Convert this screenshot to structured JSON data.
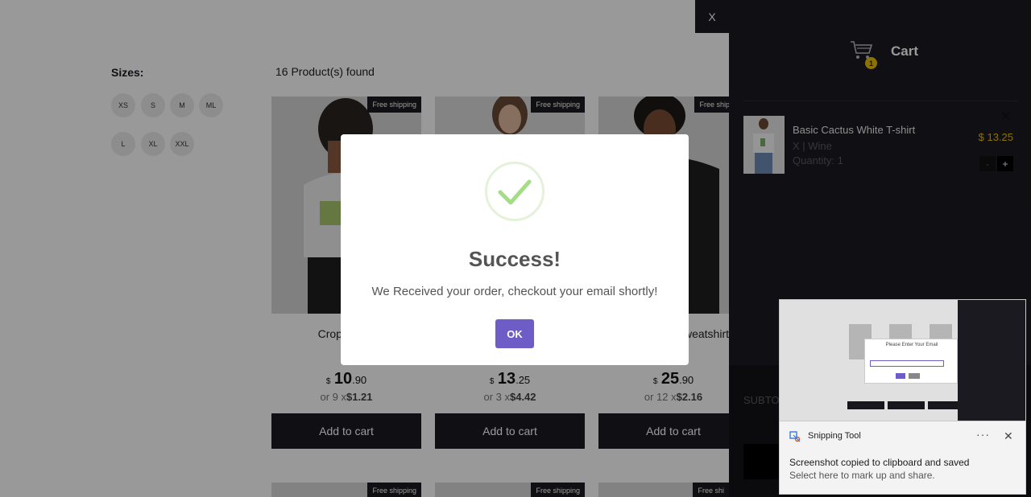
{
  "filters": {
    "title": "Sizes:",
    "sizes": [
      "XS",
      "S",
      "M",
      "ML",
      "L",
      "XL",
      "XXL"
    ]
  },
  "results": {
    "count_text": "16 Product(s) found"
  },
  "products": [
    {
      "badge": "Free shipping",
      "name": "Cropped St",
      "name_line2": "w",
      "currency": "$",
      "price_int": "10",
      "price_cents": ".90",
      "install_prefix": "or 9 x",
      "install_value": "$1.21",
      "add_label": "Add to cart"
    },
    {
      "badge": "Free shipping",
      "name": "",
      "name_line2": "",
      "currency": "$",
      "price_int": "13",
      "price_cents": ".25",
      "install_prefix": "or 3 x",
      "install_value": "$4.42",
      "add_label": "Add to cart"
    },
    {
      "badge": "Free shipping",
      "name": "weatshirt",
      "name_line2": "",
      "currency": "$",
      "price_int": "25",
      "price_cents": ".90",
      "install_prefix": "or 12 x",
      "install_value": "$2.16",
      "add_label": "Add to cart"
    }
  ],
  "products_row2": [
    {
      "badge": "Free shipping"
    },
    {
      "badge": "Free shipping"
    },
    {
      "badge": "Free shi"
    }
  ],
  "cart": {
    "close_label": "X",
    "title": "Cart",
    "badge_count": "1",
    "item": {
      "name": "Basic Cactus White T-shirt",
      "desc": "X | Wine",
      "qty": "Quantity: 1",
      "price": "$ 13.25",
      "remove": "✕",
      "minus": "-",
      "plus": "+"
    },
    "subtotal_label": "SUBTOT"
  },
  "modal": {
    "title": "Success!",
    "message": "We Received your order, checkout your email shortly!",
    "ok_label": "OK"
  },
  "snipping_tool": {
    "app_name": "Snipping Tool",
    "more": "···",
    "close": "✕",
    "message": "Screenshot copied to clipboard and saved",
    "sub": "Select here to mark up and share.",
    "preview": {
      "modal_title": "Please Enter Your Email"
    }
  },
  "colors": {
    "accent": "#6e5cc7",
    "dark": "#1b1a20",
    "price_yellow": "#eabf00",
    "check_green": "#a5dc86"
  }
}
